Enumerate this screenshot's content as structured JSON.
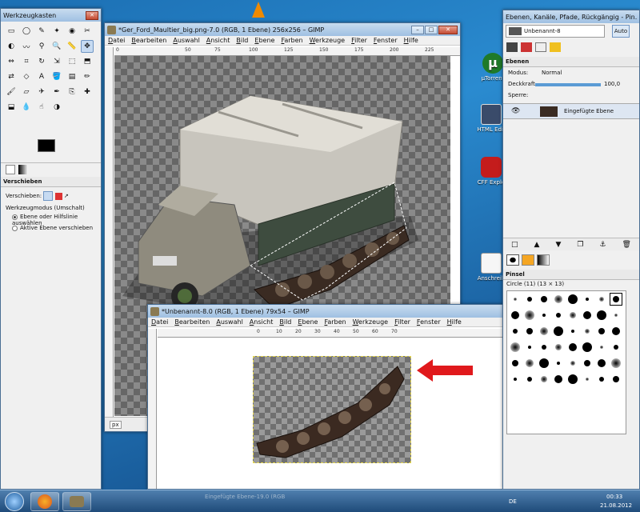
{
  "toolbox": {
    "title": "Werkzeugkasten",
    "tool_options_label": "Verschieben",
    "move_label": "Verschieben:",
    "mode_label": "Werkzeugmodus (Umschalt)",
    "opt1": "Ebene oder Hilfslinie auswählen",
    "opt2": "Aktive Ebene verschieben"
  },
  "main": {
    "title": "*Ger_Ford_Maultier_big.png-7.0 (RGB, 1 Ebene) 256x256 – GIMP",
    "menu": [
      "Datei",
      "Bearbeiten",
      "Auswahl",
      "Ansicht",
      "Bild",
      "Ebene",
      "Farben",
      "Werkzeuge",
      "Filter",
      "Fenster",
      "Hilfe"
    ],
    "ruler": [
      "0",
      "50",
      "75",
      "100",
      "125",
      "150",
      "175",
      "200",
      "225"
    ],
    "unit": "px"
  },
  "second": {
    "title": "*Unbenannt-8.0 (RGB, 1 Ebene) 79x54 – GIMP",
    "menu": [
      "Datei",
      "Bearbeiten",
      "Auswahl",
      "Ansicht",
      "Bild",
      "Ebene",
      "Farben",
      "Werkzeuge",
      "Filter",
      "Fenster",
      "Hilfe"
    ],
    "ruler": [
      "0",
      "10",
      "20",
      "30",
      "40",
      "50",
      "60",
      "70"
    ]
  },
  "dock": {
    "title": "Ebenen, Kanäle, Pfade, Rückgängig - Pin...",
    "image_select": "Unbenannt-8",
    "auto": "Auto",
    "layers_title": "Ebenen",
    "mode_label": "Modus:",
    "mode_value": "Normal",
    "opacity_label": "Deckkraft",
    "opacity_value": "100,0",
    "lock_label": "Sperre:",
    "layer_name": "Eingefügte Ebene",
    "brush_title": "Pinsel",
    "brush_name": "Circle (11) (13 × 13)"
  },
  "desktop_icons": [
    "µTorrent",
    "HTML Edit",
    "CFF Explo",
    "Anschreib"
  ],
  "taskbar": {
    "lang": "DE",
    "time": "00:33",
    "date": "21.08.2012",
    "task_label": "Eingefügte Ebene-19.0 (RGB"
  },
  "colors": {
    "arrow": "#e0191c",
    "selection": "#e8d84a"
  }
}
